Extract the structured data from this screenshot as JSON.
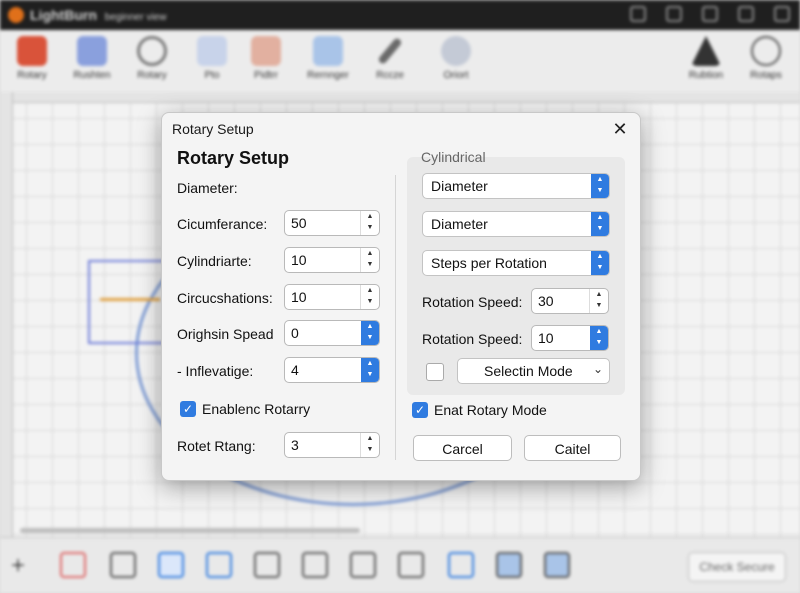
{
  "app": {
    "title": "LightBurn",
    "subtitle": "beginner view"
  },
  "toolbar": {
    "items": [
      {
        "label": "Rotary"
      },
      {
        "label": "Rushten"
      },
      {
        "label": "Rotary"
      },
      {
        "label": "Pto"
      },
      {
        "label": "Pidtrr"
      },
      {
        "label": "Rernnger"
      },
      {
        "label": "Rccze"
      },
      {
        "label": "Oriort"
      },
      {
        "label": "Rubtion"
      },
      {
        "label": "Rotaps"
      }
    ]
  },
  "bottombar": {
    "button_label": "Check Secure"
  },
  "dialog": {
    "title": "Rotary Setup",
    "close_glyph": "✕",
    "heading": "Rotary Setup",
    "left": {
      "diameter_label": "Diameter:",
      "fields": [
        {
          "label": "Cicumferance:",
          "value": "50"
        },
        {
          "label": "Cylindriarte:",
          "value": "10"
        },
        {
          "label": "Circucshations:",
          "value": "10"
        },
        {
          "label": "Orighsin Spead",
          "value": "0"
        },
        {
          "label": "- Inflevatige:",
          "value": "4"
        }
      ],
      "enable_checkbox_label": "Enablenc Rotarry",
      "rotet_label": "Rotet Rtang:",
      "rotet_value": "3"
    },
    "right": {
      "group_title": "Cylindrical",
      "select1": "Diameter",
      "select2": "Diameter",
      "select3": "Steps per Rotation",
      "speed1_label": "Rotation Speed:",
      "speed1_value": "30",
      "speed2_label": "Rotation Speed:",
      "speed2_value": "10",
      "mode_select": "Selectin Mode",
      "enat_label": "Enat Rotary Mode"
    },
    "buttons": {
      "cancel": "Carcel",
      "other": "Caitel"
    }
  },
  "colors": {
    "accent": "#2f7be0",
    "titlebar": "#1f1f1f"
  }
}
